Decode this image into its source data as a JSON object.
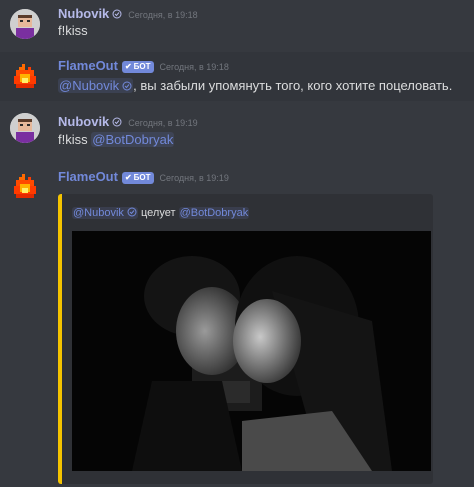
{
  "messages": [
    {
      "author": "Nubovik",
      "timestamp": "Сегодня, в 19:18",
      "text": "f!kiss"
    },
    {
      "author": "FlameOut",
      "bot_badge": "БОТ",
      "timestamp": "Сегодня, в 19:18",
      "mention": "@Nubovik",
      "text": ", вы забыли упомянуть того, кого хотите поцеловать."
    },
    {
      "author": "Nubovik",
      "timestamp": "Сегодня, в 19:19",
      "text": "f!kiss",
      "mention": "@BotDobryak"
    },
    {
      "author": "FlameOut",
      "bot_badge": "БОТ",
      "timestamp": "Сегодня, в 19:19",
      "embed": {
        "mention_from": "@Nubovik",
        "action": "целует",
        "mention_to": "@BotDobryak",
        "image": "black-and-white photo of a couple kissing",
        "accent_color": "#f5c400"
      }
    }
  ],
  "colors": {
    "background": "#36393f",
    "mention": "#7289da",
    "bot_badge": "#7289da"
  },
  "icons": [
    "verified-user-icon",
    "bot-check-icon",
    "fire-avatar-icon",
    "pixel-avatar-icon"
  ]
}
